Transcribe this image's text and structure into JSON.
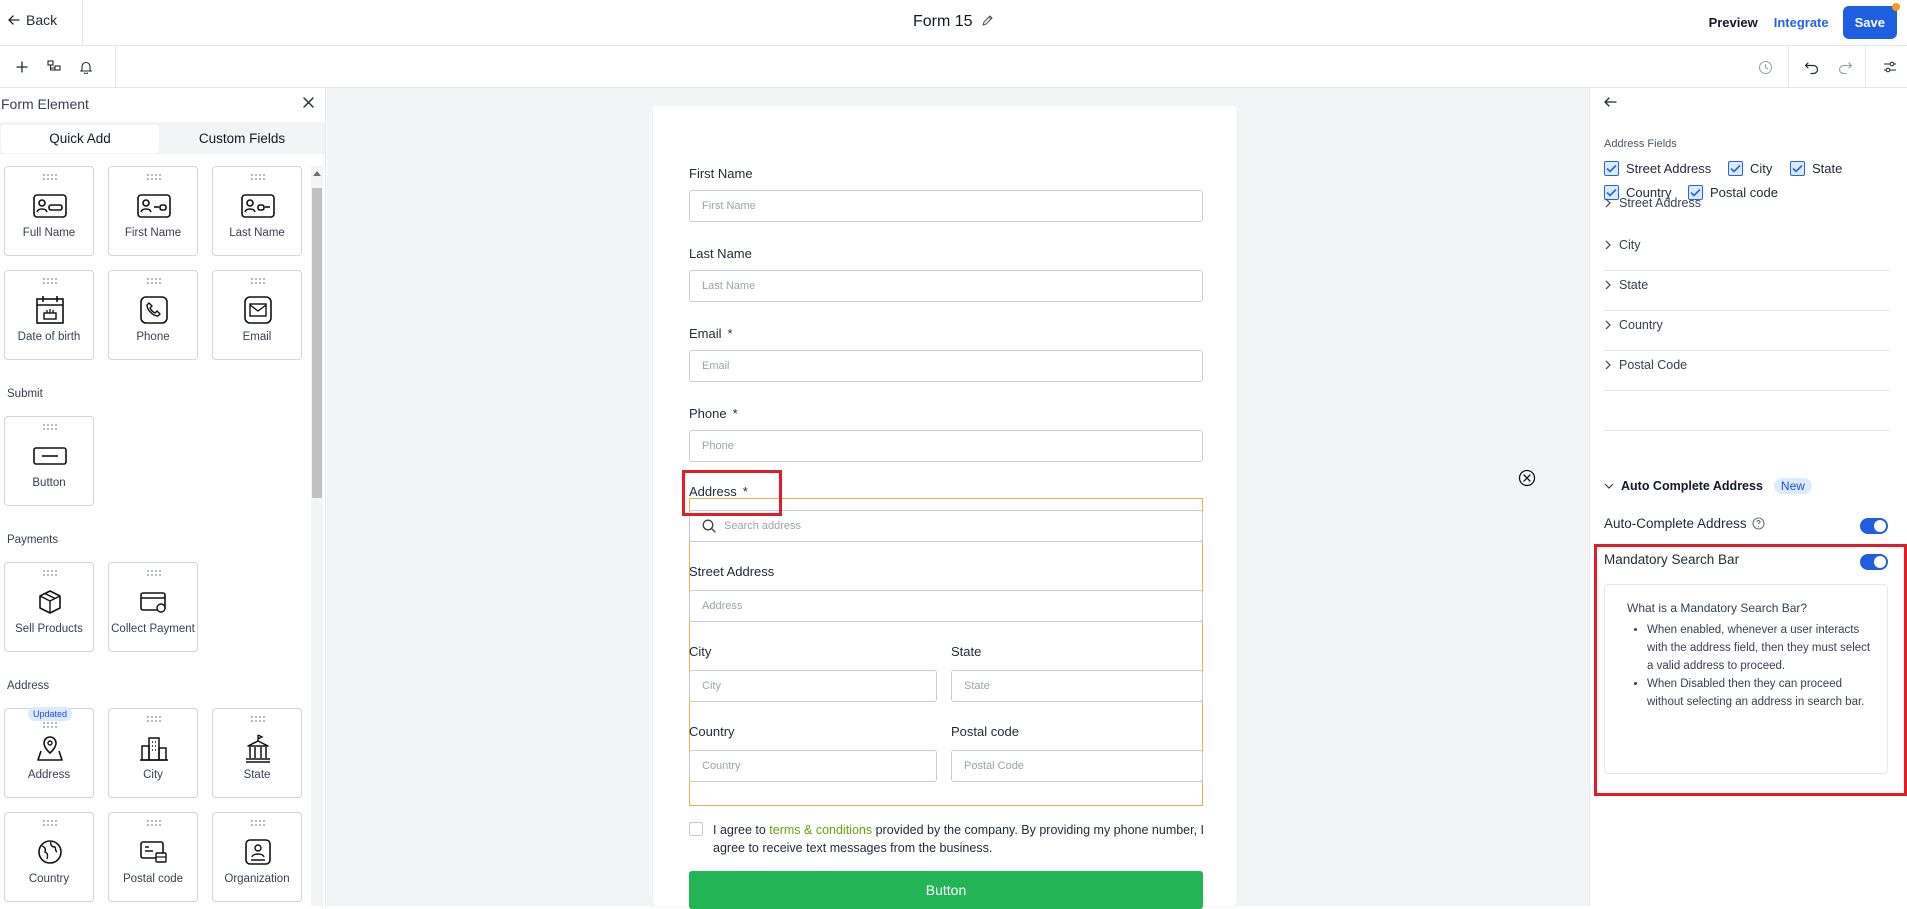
{
  "topbar": {
    "back_label": "Back",
    "form_title": "Form 15",
    "preview_label": "Preview",
    "integrate_label": "Integrate",
    "save_label": "Save"
  },
  "left_panel": {
    "title": "Form Element",
    "tabs": [
      "Quick Add",
      "Custom Fields"
    ],
    "active_tab": "Quick Add",
    "row1": [
      "Full Name",
      "First Name",
      "Last Name"
    ],
    "row2": [
      "Date of birth",
      "Phone",
      "Email"
    ],
    "submit_section": "Submit",
    "submit_items": [
      "Button"
    ],
    "payments_section": "Payments",
    "payment_items": [
      "Sell Products",
      "Collect Payment"
    ],
    "address_section": "Address",
    "address_badge": "Updated",
    "address_row1": [
      "Address",
      "City",
      "State"
    ],
    "address_row2": [
      "Country",
      "Postal code",
      "Organization"
    ]
  },
  "form": {
    "first_name_label": "First Name",
    "first_name_placeholder": "First Name",
    "last_name_label": "Last Name",
    "last_name_placeholder": "Last Name",
    "email_label": "Email",
    "email_placeholder": "Email",
    "phone_label": "Phone",
    "phone_placeholder": "Phone",
    "required_mark": "*",
    "address_label": "Address",
    "search_placeholder": "Search address",
    "street_label": "Street Address",
    "street_placeholder": "Address",
    "city_label": "City",
    "city_placeholder": "City",
    "state_label": "State",
    "state_placeholder": "State",
    "country_label": "Country",
    "country_placeholder": "Country",
    "postal_label": "Postal code",
    "postal_placeholder": "Postal Code",
    "consent_prefix": "I agree to ",
    "consent_link": "terms & conditions",
    "consent_suffix": " provided by the company. By providing my phone number, I agree to receive text messages from the business.",
    "button_label": "Button"
  },
  "right_panel": {
    "address_fields_label": "Address Fields",
    "checkboxes": [
      {
        "label": "Street Address",
        "checked": true
      },
      {
        "label": "City",
        "checked": true
      },
      {
        "label": "State",
        "checked": true
      },
      {
        "label": "Country",
        "checked": true
      },
      {
        "label": "Postal code",
        "checked": true
      }
    ],
    "accordions": [
      "Street Address",
      "City",
      "State",
      "Country",
      "Postal Code"
    ],
    "auto_complete_section": "Auto Complete Address",
    "new_badge": "New",
    "auto_complete_label": "Auto-Complete Address",
    "auto_complete_on": true,
    "mandatory_label": "Mandatory Search Bar",
    "mandatory_on": true,
    "info_question": "What is a Mandatory Search Bar?",
    "info_points": [
      "When enabled, whenever a user interacts with the address field, then they must select a valid address to proceed.",
      "When Disabled then they can proceed without selecting an address in search bar."
    ]
  },
  "colors": {
    "accent": "#1d5fe0",
    "highlight": "#e11d2a",
    "form_button": "#22b455",
    "selection_border": "#e8b04a",
    "link": "#65a30d"
  }
}
